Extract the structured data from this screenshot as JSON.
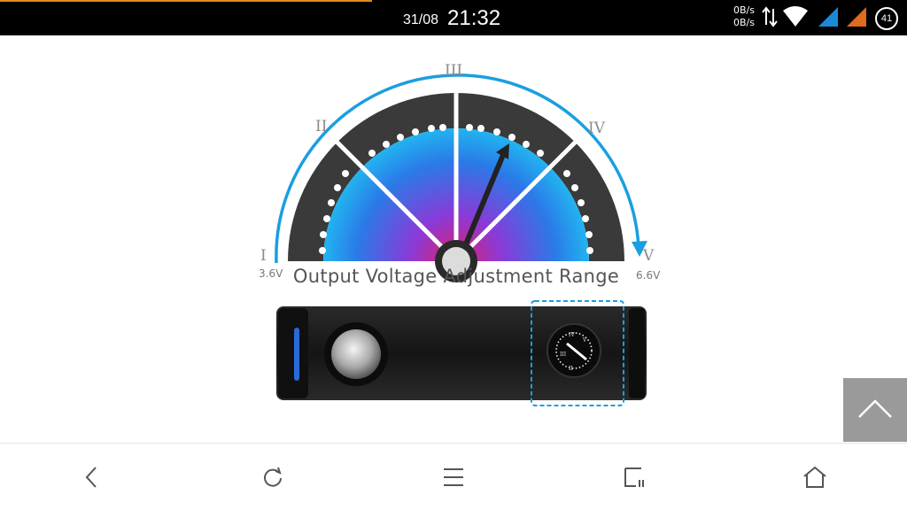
{
  "status_bar": {
    "date": "31/08",
    "time": "21:32",
    "net_up": "0B/s",
    "net_down": "0B/s",
    "battery": "41"
  },
  "gauge": {
    "title": "Output Voltage Adjustment Range",
    "min_label": "3.6V",
    "max_label": "6.6V",
    "levels": [
      "I",
      "II",
      "III",
      "IV",
      "V"
    ]
  },
  "colors": {
    "accent": "#1a9ee0",
    "gauge_dark": "#3a3a3a",
    "status_bar": "#000000",
    "scroll_top_bg": "#9a9a9a"
  },
  "nav": {
    "items": [
      "back-icon",
      "refresh-icon",
      "menu-icon",
      "tabs-icon",
      "home-icon"
    ]
  }
}
